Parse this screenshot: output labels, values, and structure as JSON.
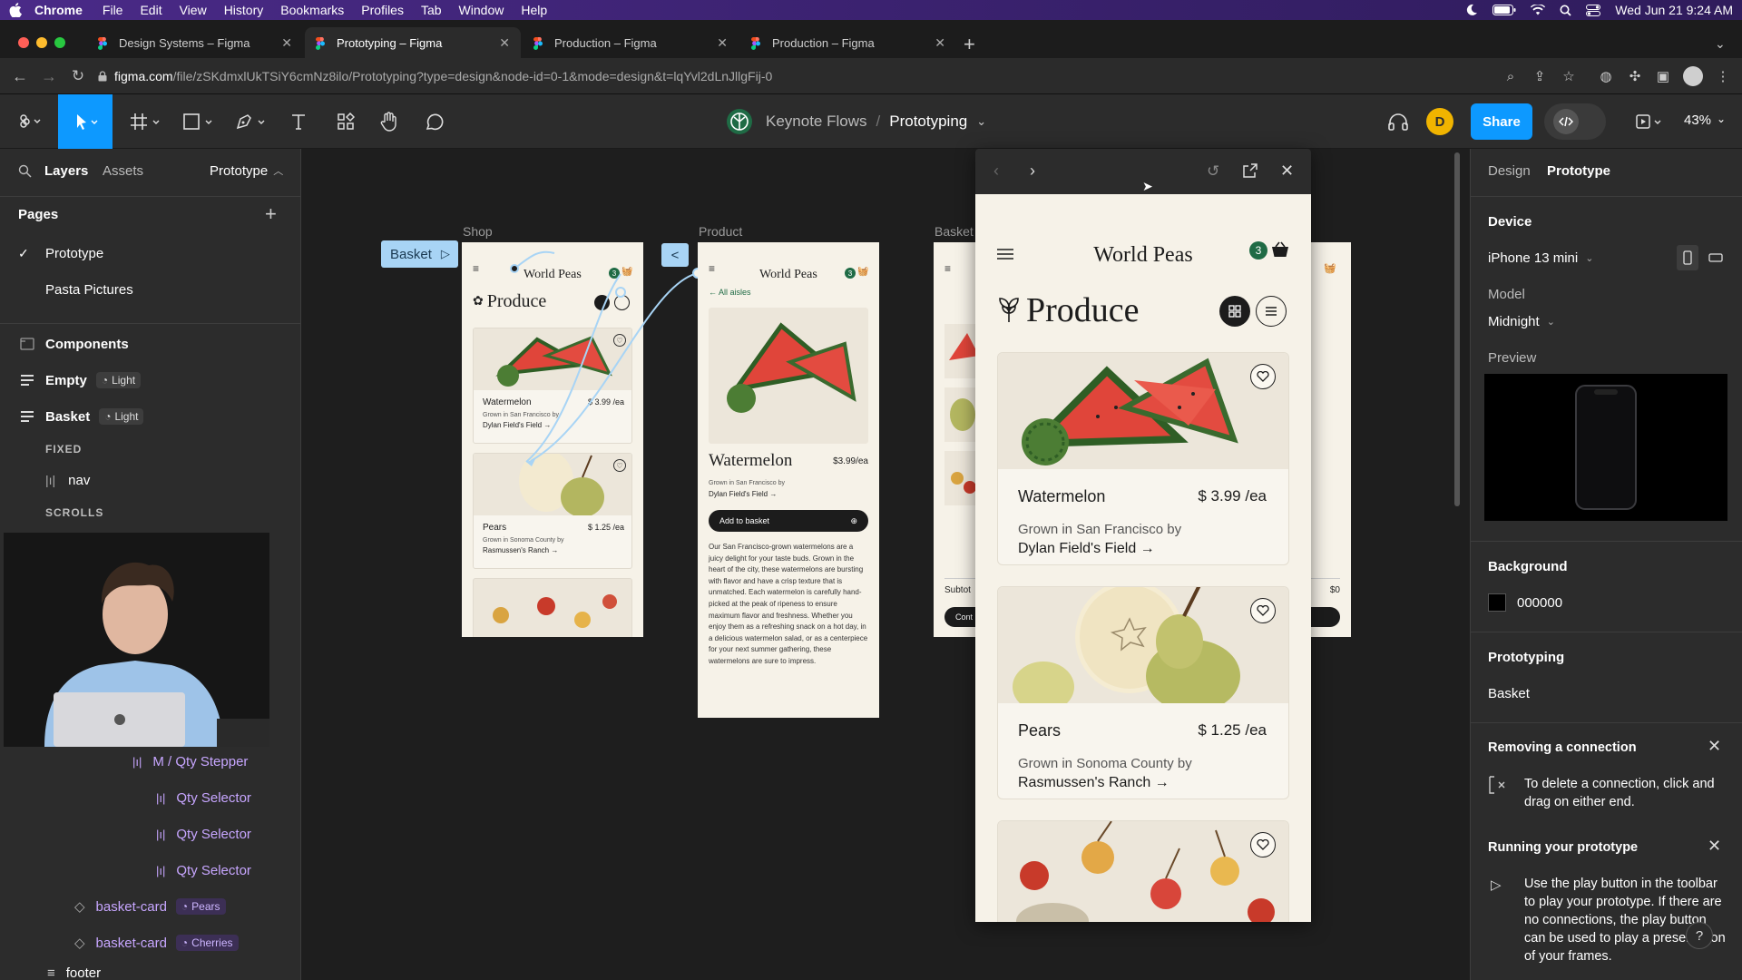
{
  "mac_menu": {
    "app": "Chrome",
    "items": [
      "File",
      "Edit",
      "View",
      "History",
      "Bookmarks",
      "Profiles",
      "Tab",
      "Window",
      "Help"
    ],
    "datetime": "Wed Jun 21  9:24 AM"
  },
  "browser": {
    "tabs": [
      {
        "title": "Design Systems – Figma",
        "active": false
      },
      {
        "title": "Prototyping – Figma",
        "active": true
      },
      {
        "title": "Production – Figma",
        "active": false
      },
      {
        "title": "Production – Figma",
        "active": false
      }
    ],
    "url_host": "figma.com",
    "url_path": "/file/zSKdmxlUkTSiY6cmNz8ilo/Prototyping?type=design&node-id=0-1&mode=design&t=lqYvl2dLnJllgFij-0"
  },
  "figma_toolbar": {
    "project": "Keynote Flows",
    "separator": "/",
    "file": "Prototyping",
    "share_label": "Share",
    "avatar_initial": "D",
    "zoom": "43%"
  },
  "left_panel": {
    "tabs": [
      "Layers",
      "Assets"
    ],
    "mode_dropdown": "Prototype",
    "pages_title": "Pages",
    "pages": [
      {
        "name": "Prototype",
        "checked": true
      },
      {
        "name": "Pasta Pictures",
        "checked": false
      }
    ],
    "layers": {
      "components": "Components",
      "empty": {
        "name": "Empty",
        "variant": "Light"
      },
      "basket": {
        "name": "Basket",
        "variant": "Light"
      },
      "fixed_label": "FIXED",
      "nav": "nav",
      "scrolls_label": "SCROLLS",
      "qty_stepper": "M / Qty Stepper",
      "qty_selectors": [
        "Qty Selector",
        "Qty Selector",
        "Qty Selector"
      ],
      "basket_cards": [
        {
          "name": "basket-card",
          "variant": "Pears"
        },
        {
          "name": "basket-card",
          "variant": "Cherries"
        }
      ],
      "footer": "footer"
    }
  },
  "canvas": {
    "frame_labels": {
      "shop": "Shop",
      "product": "Product",
      "basket": "Basket"
    },
    "basket_tag": "Basket",
    "shop_frame": {
      "brand": "World Peas",
      "cart_count": "3",
      "heading": "Produce",
      "items": [
        {
          "name": "Watermelon",
          "price": "$ 3.99 /ea",
          "grown": "Grown in San Francisco by",
          "farm": "Dylan Field's Field →"
        },
        {
          "name": "Pears",
          "price": "$ 1.25 /ea",
          "grown": "Grown in Sonoma County by",
          "farm": "Rasmussen's Ranch →"
        }
      ]
    },
    "product_frame": {
      "brand": "World Peas",
      "cart_count": "3",
      "back": "← All aisles",
      "name": "Watermelon",
      "price": "$3.99/ea",
      "grown": "Grown in San Francisco by",
      "farm": "Dylan Field's Field →",
      "add_button": "Add to basket",
      "description": "Our San Francisco-grown watermelons are a juicy delight for your taste buds. Grown in the heart of the city, these watermelons are bursting with flavor and have a crisp texture that is unmatched. Each watermelon is carefully hand-picked at the peak of ripeness to ensure maximum flavor and freshness. Whether you enjoy them as a refreshing snack on a hot day, in a delicious watermelon salad, or as a centerpiece for your next summer gathering, these watermelons are sure to impress."
    },
    "basket_frame": {
      "subtotal_label": "Subtot",
      "subtotal": "$0",
      "button": "Cont"
    }
  },
  "prototype_preview": {
    "brand": "World Peas",
    "cart_count": "3",
    "heading": "Produce",
    "items": [
      {
        "name": "Watermelon",
        "price": "$ 3.99 /ea",
        "grown": "Grown in San Francisco by",
        "farm": "Dylan Field's Field →"
      },
      {
        "name": "Pears",
        "price": "$ 1.25 /ea",
        "grown": "Grown in Sonoma County by",
        "farm": "Rasmussen's Ranch →"
      }
    ]
  },
  "right_panel": {
    "tabs": [
      "Design",
      "Prototype"
    ],
    "device_title": "Device",
    "device": "iPhone 13 mini",
    "model_label": "Model",
    "model": "Midnight",
    "preview_label": "Preview",
    "background_title": "Background",
    "background_hex": "000000",
    "prototyping_title": "Prototyping",
    "prototyping_value": "Basket",
    "removing_title": "Removing a connection",
    "removing_text": "To delete a connection, click and drag on either end.",
    "running_title": "Running your prototype",
    "running_text": "Use the play button in the toolbar to play your prototype. If there are no connections, the play button can be used to play a presentation of your frames."
  },
  "colors": {
    "accent": "#0d99ff",
    "figma_panel": "#2c2c2c",
    "canvas": "#1e1e1e",
    "frame_bg": "#f6f2e8",
    "brand_green": "#1f6b45"
  }
}
